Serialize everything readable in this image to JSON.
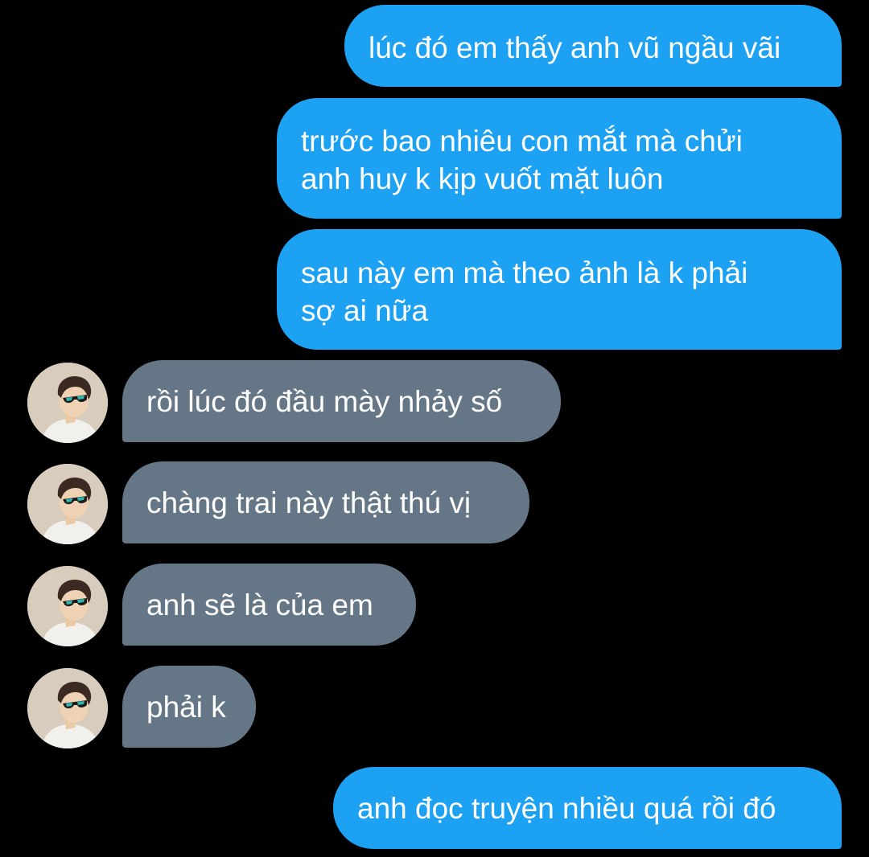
{
  "messages": [
    {
      "side": "sent",
      "text": "lúc đó em thấy anh vũ ngầu vãi"
    },
    {
      "side": "sent",
      "text": "trước bao nhiêu con mắt mà chửi\nanh huy k kịp vuốt mặt luôn"
    },
    {
      "side": "sent",
      "text": "sau này em mà theo ảnh là k phải\nsợ ai nữa"
    },
    {
      "side": "received",
      "text": "rồi lúc đó đầu mày nhảy số"
    },
    {
      "side": "received",
      "text": "chàng trai này thật thú vị"
    },
    {
      "side": "received",
      "text": "anh sẽ là của em"
    },
    {
      "side": "received",
      "text": "phải k"
    },
    {
      "side": "sent",
      "text": "anh đọc truyện nhiều quá rồi đó"
    }
  ],
  "colors": {
    "background": "#000000",
    "sent_bubble": "#1DA1F2",
    "received_bubble": "#657786",
    "text": "#FFFFFF"
  },
  "icons": {
    "avatar": "avatar-person-sunglasses-icon"
  }
}
